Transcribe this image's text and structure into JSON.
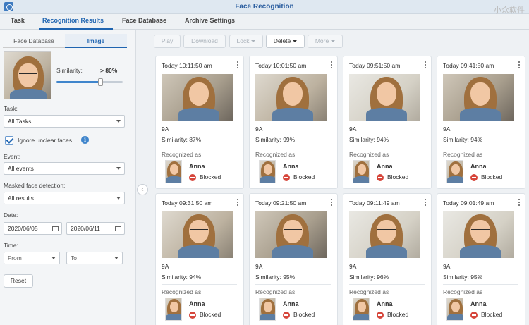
{
  "window": {
    "title": "Face Recognition",
    "watermark": "小众软件",
    "controls": "? — ▢"
  },
  "top_tabs": [
    {
      "label": "Task",
      "active": false
    },
    {
      "label": "Recognition Results",
      "active": true
    },
    {
      "label": "Face Database",
      "active": false
    },
    {
      "label": "Archive Settings",
      "active": false
    }
  ],
  "left": {
    "subtabs": {
      "face_database": "Face Database",
      "image": "Image"
    },
    "similarity_label": "Similarity:",
    "similarity_value": "> 80%",
    "similarity_level_percent": 80,
    "task_label": "Task:",
    "task_value": "All Tasks",
    "ignore_unclear_label": "Ignore unclear faces",
    "ignore_unclear_checked": true,
    "info_glyph": "i",
    "event_label": "Event:",
    "event_value": "All events",
    "masked_label": "Masked face detection:",
    "masked_value": "All results",
    "date_label": "Date:",
    "date_from": "2020/06/05",
    "date_to": "2020/06/11",
    "time_label": "Time:",
    "time_from_placeholder": "From",
    "time_to_placeholder": "To",
    "reset_label": "Reset",
    "collapse_glyph": "‹"
  },
  "toolbar": {
    "play": "Play",
    "download": "Download",
    "lock": "Lock",
    "delete": "Delete",
    "more": "More"
  },
  "cards": [
    {
      "time": "Today 10:11:50 am",
      "camera": "9A",
      "similarity": "Similarity: 87%",
      "recognized_label": "Recognized as",
      "name": "Anna",
      "status": "Blocked"
    },
    {
      "time": "Today 10:01:50 am",
      "camera": "9A",
      "similarity": "Similarity: 99%",
      "recognized_label": "Recognized as",
      "name": "Anna",
      "status": "Blocked"
    },
    {
      "time": "Today 09:51:50 am",
      "camera": "9A",
      "similarity": "Similarity: 94%",
      "recognized_label": "Recognized as",
      "name": "Anna",
      "status": "Blocked"
    },
    {
      "time": "Today 09:41:50 am",
      "camera": "9A",
      "similarity": "Similarity: 94%",
      "recognized_label": "Recognized as",
      "name": "Anna",
      "status": "Blocked"
    },
    {
      "time": "Today 09:31:50 am",
      "camera": "9A",
      "similarity": "Similarity: 94%",
      "recognized_label": "Recognized as",
      "name": "Anna",
      "status": "Blocked"
    },
    {
      "time": "Today 09:21:50 am",
      "camera": "9A",
      "similarity": "Similarity: 95%",
      "recognized_label": "Recognized as",
      "name": "Anna",
      "status": "Blocked"
    },
    {
      "time": "Today 09:11:49 am",
      "camera": "9A",
      "similarity": "Similarity: 96%",
      "recognized_label": "Recognized as",
      "name": "Anna",
      "status": "Blocked"
    },
    {
      "time": "Today 09:01:49 am",
      "camera": "9A",
      "similarity": "Similarity: 95%",
      "recognized_label": "Recognized as",
      "name": "Anna",
      "status": "Blocked"
    }
  ],
  "colors": {
    "accent": "#1f64b0",
    "blocked": "#d6463b"
  }
}
